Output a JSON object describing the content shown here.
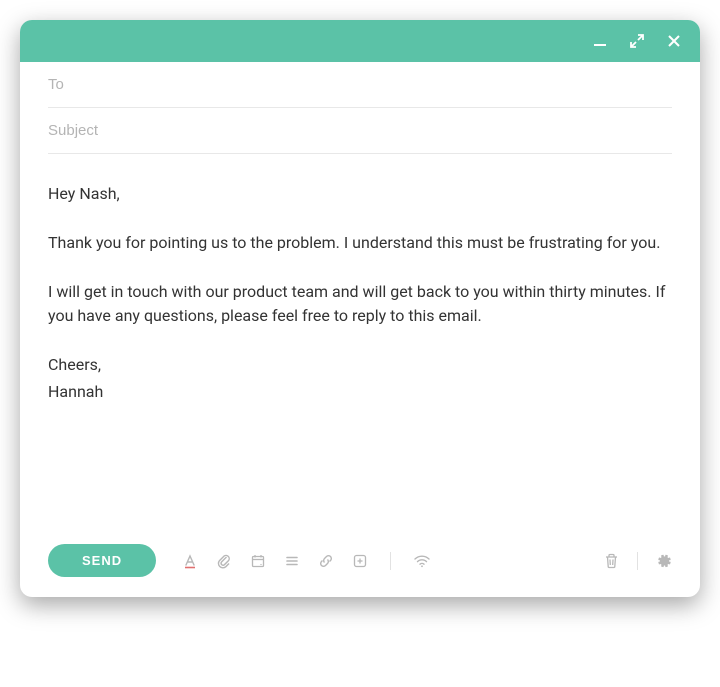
{
  "fields": {
    "to_placeholder": "To",
    "to_value": "",
    "subject_placeholder": "Subject",
    "subject_value": ""
  },
  "body": {
    "greeting": "Hey Nash,",
    "para1": "Thank you for pointing us to the problem. I understand this must be frustrating for you.",
    "para2": "I will get in touch with our product team and will get back to you within thirty minutes. If you have any questions, please feel free to reply to this email.",
    "closing": "Cheers,",
    "signature": "Hannah"
  },
  "toolbar": {
    "send_label": "SEND"
  },
  "colors": {
    "accent": "#5bc2a7"
  }
}
